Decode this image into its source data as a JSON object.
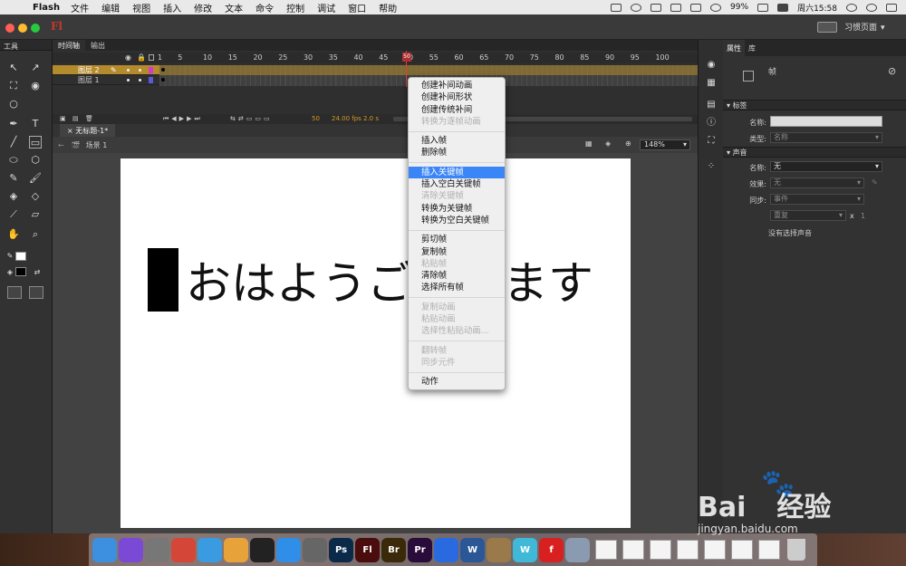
{
  "menubar": {
    "app": "Flash",
    "items": [
      "文件",
      "编辑",
      "视图",
      "插入",
      "修改",
      "文本",
      "命令",
      "控制",
      "调试",
      "窗口",
      "帮助"
    ],
    "battery": "99%",
    "clock": "周六15:58"
  },
  "titlebar": {
    "logo": "Fl",
    "workspace": "习惯页面"
  },
  "tools": {
    "tab": "工具"
  },
  "timeline": {
    "tabs": [
      "时间轴",
      "输出"
    ],
    "frame_numbers": [
      "1",
      "5",
      "10",
      "15",
      "20",
      "25",
      "30",
      "35",
      "40",
      "45",
      "50",
      "55",
      "60",
      "65",
      "70",
      "75",
      "80",
      "85",
      "90",
      "95",
      "100"
    ],
    "playhead": "50",
    "layers": [
      {
        "name": "图层 2"
      },
      {
        "name": "图层 1"
      }
    ],
    "footer": {
      "frame": "50",
      "fps": "24.00 fps",
      "time": "2.0 s"
    }
  },
  "document": {
    "tab": "无标题-1*",
    "scene": "场景 1",
    "zoom": "148%",
    "stage_text": "おはようございます"
  },
  "context_menu": {
    "groups": [
      [
        {
          "label": "创建补间动画",
          "enabled": true
        },
        {
          "label": "创建补间形状",
          "enabled": true
        },
        {
          "label": "创建传统补间",
          "enabled": true
        },
        {
          "label": "转换为逐帧动画",
          "enabled": false
        }
      ],
      [
        {
          "label": "插入帧",
          "enabled": true
        },
        {
          "label": "删除帧",
          "enabled": true
        }
      ],
      [
        {
          "label": "插入关键帧",
          "enabled": true,
          "highlight": true
        },
        {
          "label": "插入空白关键帧",
          "enabled": true
        },
        {
          "label": "清除关键帧",
          "enabled": false
        },
        {
          "label": "转换为关键帧",
          "enabled": true
        },
        {
          "label": "转换为空白关键帧",
          "enabled": true
        }
      ],
      [
        {
          "label": "剪切帧",
          "enabled": true
        },
        {
          "label": "复制帧",
          "enabled": true
        },
        {
          "label": "粘贴帧",
          "enabled": false
        },
        {
          "label": "清除帧",
          "enabled": true
        },
        {
          "label": "选择所有帧",
          "enabled": true
        }
      ],
      [
        {
          "label": "复制动画",
          "enabled": false
        },
        {
          "label": "粘贴动画",
          "enabled": false
        },
        {
          "label": "选择性粘贴动画...",
          "enabled": false
        }
      ],
      [
        {
          "label": "翻转帧",
          "enabled": false
        },
        {
          "label": "同步元件",
          "enabled": false
        }
      ],
      [
        {
          "label": "动作",
          "enabled": true
        }
      ]
    ]
  },
  "properties": {
    "tabs": [
      "属性",
      "库"
    ],
    "object_type": "帧",
    "label_section": "标签",
    "name_label": "名称:",
    "type_label": "类型:",
    "type_value": "名称",
    "sound_section": "声音",
    "sound_name_label": "名称:",
    "sound_name_value": "无",
    "effect_label": "效果:",
    "effect_value": "无",
    "sync_label": "同步:",
    "sync_value": "事件",
    "repeat_value": "重复",
    "repeat_x": "x",
    "repeat_count": "1",
    "no_sound": "没有选择声音"
  },
  "dock": {
    "apps": [
      {
        "name": "finder",
        "color": "#3d8fe0",
        "label": ""
      },
      {
        "name": "siri",
        "color": "#7a4ad6",
        "label": ""
      },
      {
        "name": "launchpad",
        "color": "#777777",
        "label": ""
      },
      {
        "name": "chrome",
        "color": "#d44638",
        "label": ""
      },
      {
        "name": "safari",
        "color": "#3a9be0",
        "label": ""
      },
      {
        "name": "photos",
        "color": "#e8a23a",
        "label": ""
      },
      {
        "name": "qq",
        "color": "#222222",
        "label": ""
      },
      {
        "name": "app-store",
        "color": "#2f8ee8",
        "label": ""
      },
      {
        "name": "system-preferences",
        "color": "#666666",
        "label": ""
      },
      {
        "name": "photoshop",
        "color": "#0b2a4a",
        "label": "Ps"
      },
      {
        "name": "flash",
        "color": "#4a0c0c",
        "label": "Fl"
      },
      {
        "name": "bridge",
        "color": "#3a2a0a",
        "label": "Br"
      },
      {
        "name": "premiere",
        "color": "#2a0c3a",
        "label": "Pr"
      },
      {
        "name": "quicktime",
        "color": "#2a6ae0",
        "label": ""
      },
      {
        "name": "word",
        "color": "#2b5797",
        "label": "W"
      },
      {
        "name": "archive-utility",
        "color": "#9a7a4a",
        "label": ""
      },
      {
        "name": "w-app",
        "color": "#40b8d8",
        "label": "W"
      },
      {
        "name": "flash-player",
        "color": "#d82020",
        "label": "f"
      },
      {
        "name": "preview",
        "color": "#8a9ab0",
        "label": ""
      }
    ]
  },
  "watermark": {
    "brand": "Bai",
    "brand2": "经验",
    "url": "jingyan.baidu.com"
  }
}
